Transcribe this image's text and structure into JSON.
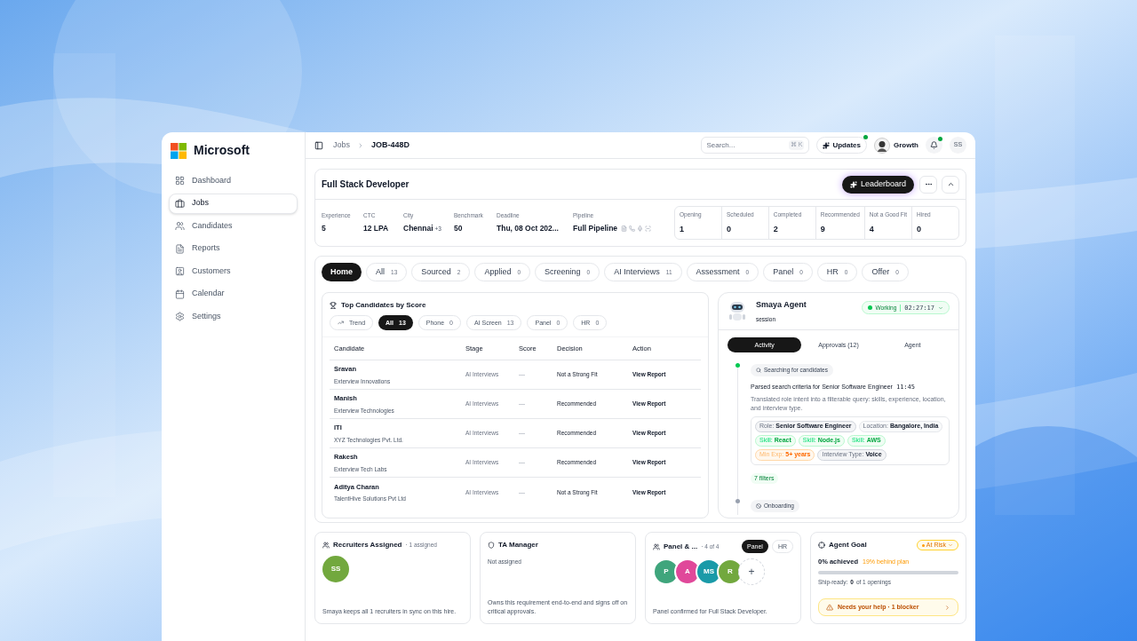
{
  "brand": "Microsoft",
  "sidebar": {
    "items": [
      {
        "label": "Dashboard",
        "selected": false
      },
      {
        "label": "Jobs",
        "selected": true
      },
      {
        "label": "Candidates",
        "selected": false
      },
      {
        "label": "Reports",
        "selected": false
      },
      {
        "label": "Customers",
        "selected": false
      },
      {
        "label": "Calendar",
        "selected": false
      },
      {
        "label": "Settings",
        "selected": false
      }
    ]
  },
  "breadcrumb": [
    "Jobs",
    "JOB-448D"
  ],
  "topbar": {
    "search_placeholder": "Search...",
    "shortcut": "⌘ K",
    "updates": "Updates",
    "updates_dot": true,
    "workspace": "Growth",
    "notifications_dot": true,
    "user_initials": "SS"
  },
  "job": {
    "title": "Full Stack Developer",
    "leaderboard": "Leaderboard",
    "fields": [
      {
        "label": "Experience",
        "value": "5"
      },
      {
        "label": "CTC",
        "value": "12 LPA"
      },
      {
        "label": "City",
        "value": "Chennai",
        "extra": "+3"
      },
      {
        "label": "Benchmark",
        "value": "50"
      },
      {
        "label": "Deadline",
        "value": "Thu, 08 Oct 202..."
      },
      {
        "label": "Pipeline",
        "value": "Full Pipeline"
      }
    ],
    "stats": [
      {
        "label": "Opening",
        "value": "1"
      },
      {
        "label": "Scheduled",
        "value": "0"
      },
      {
        "label": "Completed",
        "value": "2"
      },
      {
        "label": "Recommended",
        "value": "9"
      },
      {
        "label": "Not a Good Fit",
        "value": "4"
      },
      {
        "label": "Hired",
        "value": "0"
      }
    ]
  },
  "stage_tabs": [
    {
      "label": "Home",
      "selected": true
    },
    {
      "label": "All",
      "count": "13",
      "selected": false
    },
    {
      "label": "Sourced",
      "count": "2",
      "selected": false
    },
    {
      "label": "Applied",
      "count": "0",
      "selected": false
    },
    {
      "label": "Screening",
      "count": "0",
      "selected": false
    },
    {
      "label": "AI Interviews",
      "count": "11",
      "selected": false
    },
    {
      "label": "Assessment",
      "count": "0",
      "selected": false
    },
    {
      "label": "Panel",
      "count": "0",
      "selected": false
    },
    {
      "label": "HR",
      "count": "0",
      "selected": false
    },
    {
      "label": "Offer",
      "count": "0",
      "selected": false
    }
  ],
  "top_candidates": {
    "title": "Top Candidates by Score",
    "filters": [
      {
        "label": "Trend",
        "kind": "trend",
        "selected": false
      },
      {
        "label": "All",
        "count": "13",
        "selected": true
      },
      {
        "label": "Phone",
        "count": "0",
        "selected": false
      },
      {
        "label": "AI Screen",
        "count": "13",
        "selected": false
      },
      {
        "label": "Panel",
        "count": "0",
        "selected": false
      },
      {
        "label": "HR",
        "count": "0",
        "selected": false
      }
    ],
    "columns": [
      "Candidate",
      "Stage",
      "Score",
      "Decision",
      "Action"
    ],
    "rows": [
      {
        "name": "Sravan",
        "company": "Exterview Innovations",
        "stage": "AI Interviews",
        "score": "—",
        "decision": "Not a Strong Fit",
        "action": "View Report"
      },
      {
        "name": "Manish",
        "company": "Exterview Technologies",
        "stage": "AI Interviews",
        "score": "—",
        "decision": "Recommended",
        "action": "View Report"
      },
      {
        "name": "ITI",
        "company": "XYZ Technologies Pvt. Ltd.",
        "stage": "AI Interviews",
        "score": "—",
        "decision": "Recommended",
        "action": "View Report"
      },
      {
        "name": "Rakesh",
        "company": "Exterview Tech Labs",
        "stage": "AI Interviews",
        "score": "—",
        "decision": "Recommended",
        "action": "View Report"
      },
      {
        "name": "Aditya Charan",
        "company": "TalentHive Solutions Pvt Ltd",
        "stage": "AI Interviews",
        "score": "—",
        "decision": "Not a Strong Fit",
        "action": "View Report"
      }
    ]
  },
  "agent": {
    "name": "Smaya Agent",
    "subtitle": "session",
    "status": "Working",
    "timer": "02:27:17",
    "tabs": [
      {
        "label": "Activity",
        "selected": true
      },
      {
        "label": "Approvals (12)",
        "selected": false
      },
      {
        "label": "Agent",
        "selected": false
      }
    ],
    "events": [
      {
        "tag": "Searching for candidates",
        "kind": "search",
        "active": true,
        "title": "Parsed search criteria for Senior Software Engineer",
        "time": "11:45",
        "description": "Translated role intent into a filterable query: skills, experience, location, and interview type.",
        "chips": [
          {
            "key": "Role:",
            "value": "Senior Software Engineer",
            "kind": "strong"
          },
          {
            "key": "Location:",
            "value": "Bangalore, India",
            "kind": "neutral"
          },
          {
            "key": "Skill:",
            "value": "React",
            "kind": "skill"
          },
          {
            "key": "Skill:",
            "value": "Node.js",
            "kind": "skill"
          },
          {
            "key": "Skill:",
            "value": "AWS",
            "kind": "skill"
          },
          {
            "key": "Min Exp:",
            "value": "5+ years",
            "kind": "experience"
          },
          {
            "key": "Interview Type:",
            "value": "Voice",
            "kind": "strong"
          }
        ],
        "filters_count": "7 filters"
      },
      {
        "tag": "Onboarding",
        "kind": "status",
        "active": false
      }
    ]
  },
  "cards": {
    "recruiters": {
      "title": "Recruiters Assigned",
      "count": "· 1 assigned",
      "avatars": [
        {
          "initials": "SS",
          "color": "#72a83e"
        }
      ],
      "note": "Smaya keeps all 1 recruiters in sync on this hire."
    },
    "ta_manager": {
      "title": "TA Manager",
      "status": "Not assigned",
      "note": "Owns this requirement end-to-end and signs off on critical approvals."
    },
    "panel": {
      "title": "Panel & ...",
      "count": "· 4 of 4",
      "tabs": [
        {
          "label": "Panel",
          "selected": true
        },
        {
          "label": "HR",
          "selected": false
        }
      ],
      "avatars": [
        {
          "initials": "P",
          "color": "#3fa57c"
        },
        {
          "initials": "A",
          "color": "#e0489a"
        },
        {
          "initials": "MS",
          "color": "#1a9aa8"
        },
        {
          "initials": "R",
          "color": "#72a83e"
        }
      ],
      "add": "+",
      "note": "Panel confirmed for Full Stack Developer."
    },
    "goal": {
      "title": "Agent Goal",
      "badge": "At Risk",
      "achieved": "0% achieved",
      "behind": "19% behind plan",
      "level": 0,
      "ship_label": "Ship-ready:",
      "ship_count": "0",
      "ship_rest": "of 1 openings",
      "alert": "Needs your help · 1 blocker"
    }
  }
}
